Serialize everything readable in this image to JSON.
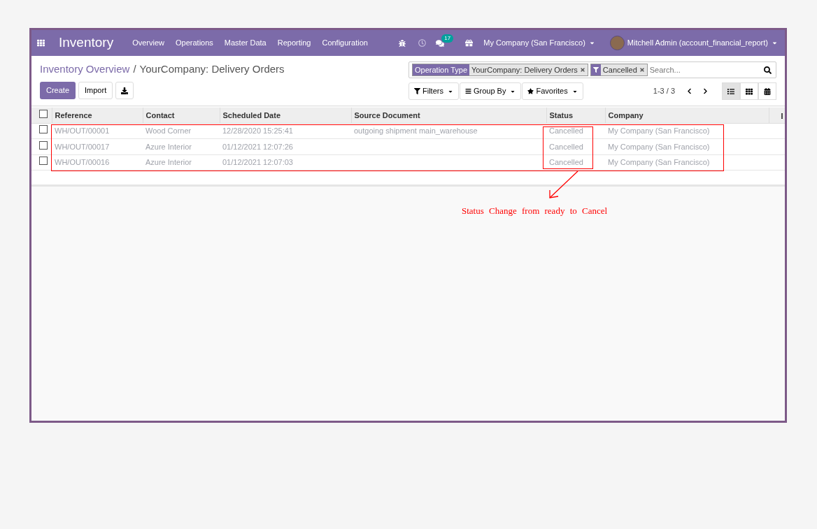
{
  "navbar": {
    "app_name": "Inventory",
    "menu": [
      "Overview",
      "Operations",
      "Master Data",
      "Reporting",
      "Configuration"
    ],
    "messages_badge": "17",
    "company": "My Company (San Francisco)",
    "user": "Mitchell Admin (account_financial_report)"
  },
  "breadcrumb_separator": "/",
  "breadcrumb": [
    {
      "label": "Inventory Overview",
      "link": true
    },
    {
      "label": "YourCompany: Delivery Orders",
      "link": false
    }
  ],
  "buttons": {
    "create": "Create",
    "import": "Import"
  },
  "search": {
    "facets": [
      {
        "kind": "field",
        "label": "Operation Type",
        "value": "YourCompany: Delivery Orders"
      },
      {
        "kind": "filter",
        "value": "Cancelled"
      }
    ],
    "placeholder": "Search..."
  },
  "search_options": [
    "Filters",
    "Group By",
    "Favorites"
  ],
  "pager": "1-3 / 3",
  "views": [
    {
      "kind": "list",
      "selected": true
    },
    {
      "kind": "kanban",
      "selected": false
    },
    {
      "kind": "calendar",
      "selected": false
    }
  ],
  "table": {
    "select_all_checked": false,
    "columns": [
      "Reference",
      "Contact",
      "Scheduled Date",
      "Source Document",
      "Status",
      "Company"
    ],
    "rows": [
      {
        "checked": false,
        "cells": [
          "WH/OUT/00001",
          "Wood Corner",
          "12/28/2020 15:25:41",
          "outgoing shipment main_warehouse",
          "Cancelled",
          "My Company (San Francisco)"
        ]
      },
      {
        "checked": false,
        "cells": [
          "WH/OUT/00017",
          "Azure Interior",
          "01/12/2021 12:07:26",
          "",
          "Cancelled",
          "My Company (San Francisco)"
        ]
      },
      {
        "checked": false,
        "cells": [
          "WH/OUT/00016",
          "Azure Interior",
          "01/12/2021 12:07:03",
          "",
          "Cancelled",
          "My Company (San Francisco)"
        ]
      }
    ]
  },
  "annotation": "Status Change from ready to Cancel"
}
